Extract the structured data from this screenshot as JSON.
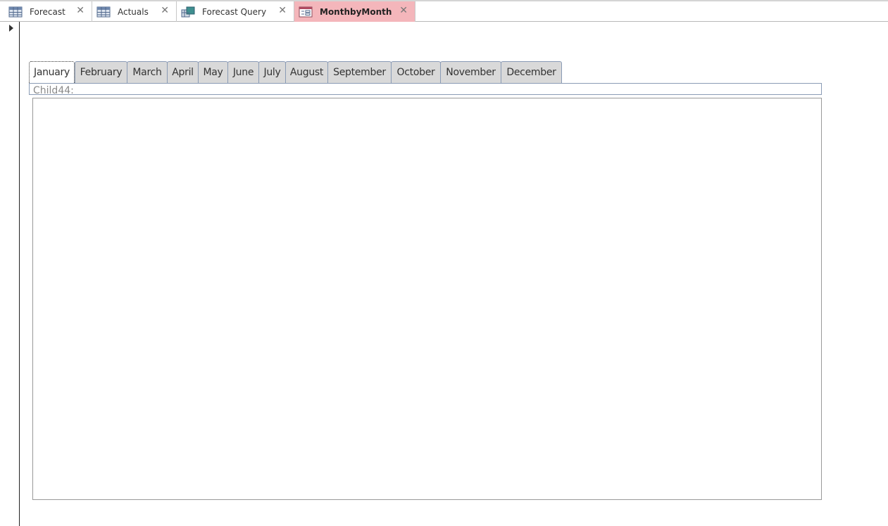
{
  "doc_tabs": [
    {
      "label": "Forecast",
      "icon": "table-icon"
    },
    {
      "label": "Actuals",
      "icon": "table-icon"
    },
    {
      "label": "Forecast Query",
      "icon": "query-icon"
    },
    {
      "label": "MonthbyMonth",
      "icon": "form-icon",
      "active": true
    }
  ],
  "close_glyph": "✕",
  "month_tabs": [
    "January",
    "February",
    "March",
    "April",
    "May",
    "June",
    "July",
    "August",
    "September",
    "October",
    "November",
    "December"
  ],
  "subform_label": "Child44:",
  "colors": {
    "active_tab": "#f4b6bb",
    "tab_border": "#8a9bb5"
  }
}
